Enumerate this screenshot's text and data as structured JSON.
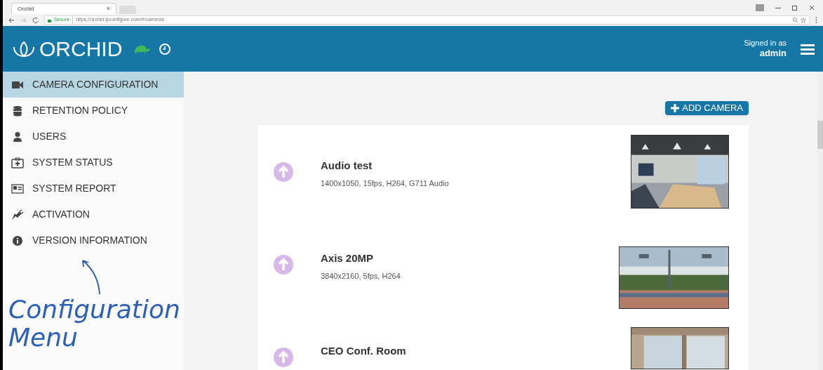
{
  "browser": {
    "tab_title": "Orchid",
    "tab_close": "×",
    "address_secure": "Secure",
    "address_url": "https://orchid.ipconfigure.com/#/cameras"
  },
  "header": {
    "logo_text": "ORCHID",
    "signed_in_label": "Signed in as",
    "user": "admin"
  },
  "sidebar": {
    "items": [
      {
        "label": "CAMERA CONFIGURATION",
        "selected": true
      },
      {
        "label": "RETENTION POLICY",
        "selected": false
      },
      {
        "label": "USERS",
        "selected": false
      },
      {
        "label": "SYSTEM STATUS",
        "selected": false
      },
      {
        "label": "SYSTEM REPORT",
        "selected": false
      },
      {
        "label": "ACTIVATION",
        "selected": false
      },
      {
        "label": "VERSION INFORMATION",
        "selected": false
      }
    ]
  },
  "annotation": {
    "text": "Configuration Menu"
  },
  "add_camera_button": "ADD CAMERA",
  "cameras": [
    {
      "name": "Audio test",
      "details": "1400x1050, 15fps, H264, G711 Audio"
    },
    {
      "name": "Axis 20MP",
      "details": "3840x2160, 5fps, H264"
    },
    {
      "name": "CEO Conf. Room"
    }
  ]
}
